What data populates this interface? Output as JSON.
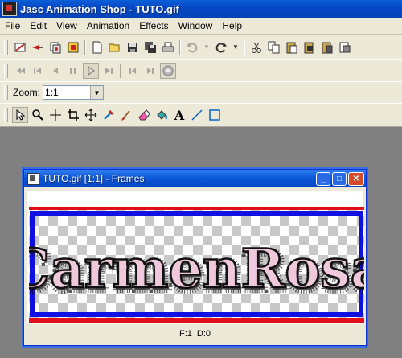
{
  "app": {
    "title": "Jasc Animation Shop - TUTO.gif"
  },
  "menu": [
    "File",
    "Edit",
    "View",
    "Animation",
    "Effects",
    "Window",
    "Help"
  ],
  "zoom": {
    "label": "Zoom:",
    "value": "1:1"
  },
  "frames_window": {
    "title": "TUTO.gif [1:1] - Frames",
    "frame_label": "F:1",
    "delay_label": "D:0",
    "image_text": "CarmenRosa",
    "border_color": "#1010e0",
    "stripe_color": "#e0101a",
    "text_fill": "#f0c8dc"
  },
  "icons": {
    "standard": [
      "wizard-icon",
      "banner-icon",
      "layers-icon",
      "animation-icon",
      "new-icon",
      "open-icon",
      "save-icon",
      "save-all-icon",
      "print-icon",
      "undo-icon",
      "redo-icon",
      "cut-icon",
      "copy-icon",
      "paste-icon",
      "paste-frame-icon",
      "paste-after-icon",
      "crop-icon"
    ],
    "playback": [
      "first-frame-icon",
      "prev-frame-icon",
      "back-icon",
      "pause-icon",
      "play-icon",
      "next-icon",
      "last-icon",
      "view-animation-icon"
    ],
    "tools": [
      "arrow-icon",
      "zoom-icon",
      "crosshair-icon",
      "crop-icon",
      "move-icon",
      "dropper-icon",
      "brush-icon",
      "eraser-icon",
      "fill-icon",
      "text-icon",
      "line-icon",
      "rectangle-icon"
    ]
  }
}
